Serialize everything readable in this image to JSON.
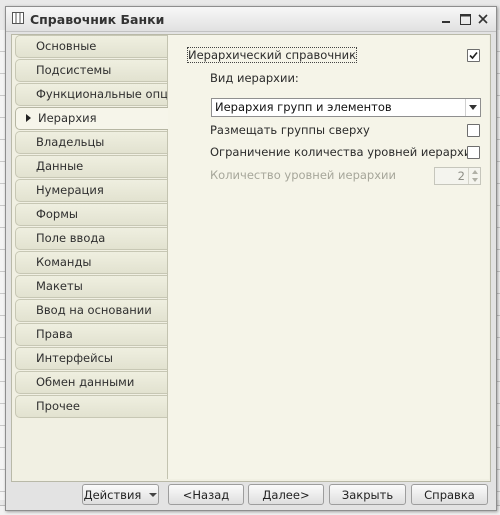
{
  "window": {
    "title": "Справочник Банки"
  },
  "tabs": [
    {
      "label": "Основные",
      "active": false
    },
    {
      "label": "Подсистемы",
      "active": false
    },
    {
      "label": "Функциональные опции",
      "active": false
    },
    {
      "label": "Иерархия",
      "active": true
    },
    {
      "label": "Владельцы",
      "active": false
    },
    {
      "label": "Данные",
      "active": false
    },
    {
      "label": "Нумерация",
      "active": false
    },
    {
      "label": "Формы",
      "active": false
    },
    {
      "label": "Поле ввода",
      "active": false
    },
    {
      "label": "Команды",
      "active": false
    },
    {
      "label": "Макеты",
      "active": false
    },
    {
      "label": "Ввод на основании",
      "active": false
    },
    {
      "label": "Права",
      "active": false
    },
    {
      "label": "Интерфейсы",
      "active": false
    },
    {
      "label": "Обмен данными",
      "active": false
    },
    {
      "label": "Прочее",
      "active": false
    }
  ],
  "hierarchy": {
    "hierarchical_label": "Иерархический справочник",
    "hierarchical_checked": true,
    "type_label": "Вид иерархии:",
    "type_value": "Иерархия групп и элементов",
    "groups_on_top_label": "Размещать группы сверху",
    "groups_on_top_checked": false,
    "limit_levels_label": "Ограничение количества уровней иерархии",
    "limit_levels_checked": false,
    "levels_count_label": "Количество уровней иерархии",
    "levels_count_value": "2"
  },
  "buttons": {
    "actions": "Действия",
    "back": "<Назад",
    "next": "Далее>",
    "close": "Закрыть",
    "help": "Справка"
  }
}
